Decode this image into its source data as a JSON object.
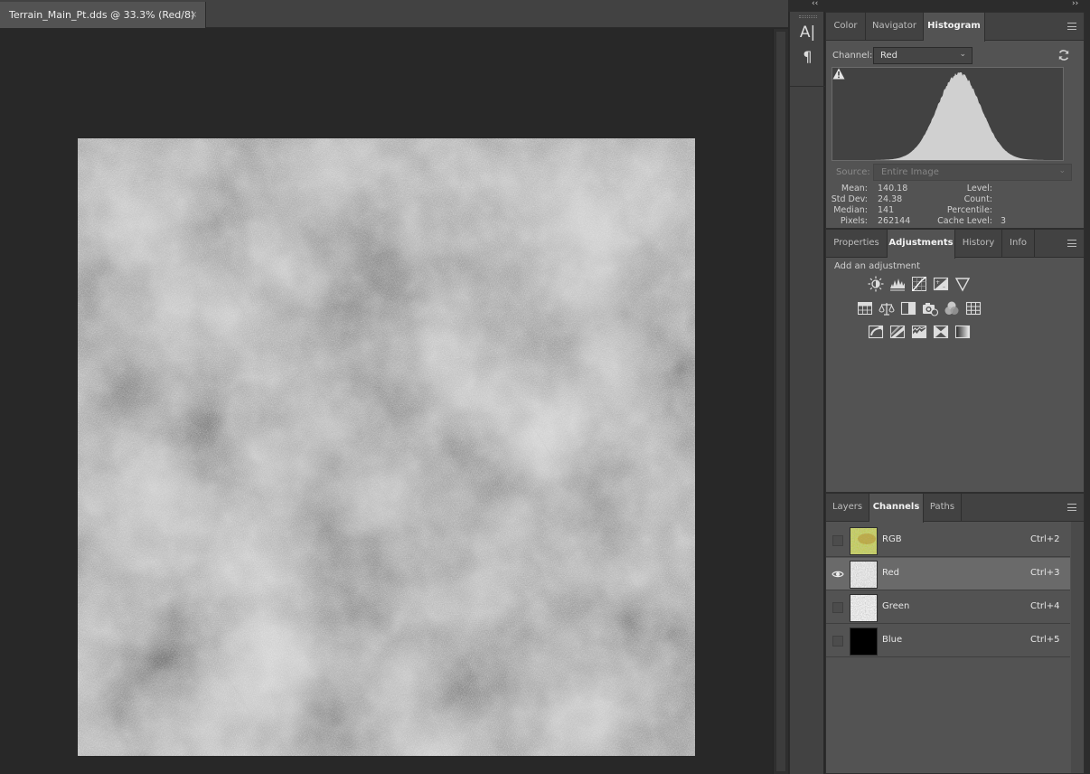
{
  "document": {
    "tab_title": "Terrain_Main_Pt.dds @ 33.3% (Red/8)",
    "close_glyph": "×"
  },
  "dock": {
    "collapse_left": "‹‹",
    "collapse_right": "››",
    "tools": [
      {
        "name": "character-panel-icon",
        "glyph": "A|"
      },
      {
        "name": "paragraph-panel-icon",
        "glyph": "¶"
      }
    ]
  },
  "histogram_panel": {
    "tabs": [
      "Color",
      "Navigator",
      "Histogram"
    ],
    "active_tab": "Histogram",
    "channel_label": "Channel:",
    "channel_value": "Red",
    "source_label": "Source:",
    "source_value": "Entire Image",
    "stats_left": [
      {
        "label": "Mean:",
        "value": "140.18"
      },
      {
        "label": "Std Dev:",
        "value": "24.38"
      },
      {
        "label": "Median:",
        "value": "141"
      },
      {
        "label": "Pixels:",
        "value": "262144"
      }
    ],
    "stats_right": [
      {
        "label": "Level:",
        "value": ""
      },
      {
        "label": "Count:",
        "value": ""
      },
      {
        "label": "Percentile:",
        "value": ""
      },
      {
        "label": "Cache Level:",
        "value": "3"
      }
    ]
  },
  "adjustments_panel": {
    "tabs": [
      "Properties",
      "Adjustments",
      "History",
      "Info"
    ],
    "active_tab": "Adjustments",
    "heading": "Add an adjustment",
    "icons": [
      [
        "brightness-contrast-icon",
        "levels-icon",
        "curves-icon",
        "exposure-icon",
        "vibrance-icon"
      ],
      [
        "hue-saturation-icon",
        "color-balance-icon",
        "black-white-icon",
        "photo-filter-icon",
        "channel-mixer-icon",
        "color-lookup-icon"
      ],
      [
        "invert-icon",
        "posterize-icon",
        "threshold-icon",
        "selective-color-icon",
        "gradient-map-icon"
      ]
    ]
  },
  "channels_panel": {
    "tabs": [
      "Layers",
      "Channels",
      "Paths"
    ],
    "active_tab": "Channels",
    "rows": [
      {
        "name": "RGB",
        "shortcut": "Ctrl+2",
        "visible": false,
        "selected": false
      },
      {
        "name": "Red",
        "shortcut": "Ctrl+3",
        "visible": true,
        "selected": true
      },
      {
        "name": "Green",
        "shortcut": "Ctrl+4",
        "visible": false,
        "selected": false
      },
      {
        "name": "Blue",
        "shortcut": "Ctrl+5",
        "visible": false,
        "selected": false
      }
    ]
  },
  "colors": {
    "panel_bg": "#535353",
    "tab_bar_bg": "#424242",
    "canvas_bg": "#282828",
    "selected_row": "#6a6a6a",
    "histogram_fill": "#d0d0d0"
  }
}
